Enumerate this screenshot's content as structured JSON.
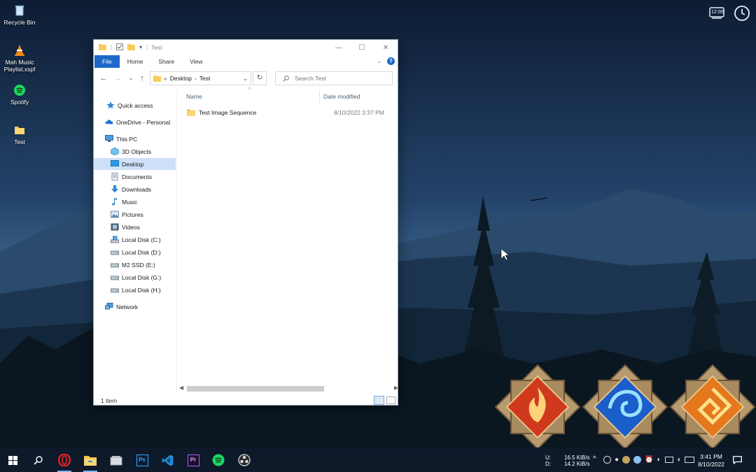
{
  "desktop": {
    "icons": [
      {
        "label": "Recycle Bin",
        "icon": "recycle-bin-icon"
      },
      {
        "label": "Mah Music Playlist.xspf",
        "icon": "vlc-cone-icon"
      },
      {
        "label": "Spotify",
        "icon": "spotify-icon"
      },
      {
        "label": "Test",
        "icon": "folder-icon"
      }
    ],
    "widgets": {
      "clock_badge": "12:00"
    }
  },
  "explorer": {
    "title": "Test",
    "ribbon_tabs": [
      "File",
      "Home",
      "Share",
      "View"
    ],
    "address": {
      "prefix": "«",
      "crumbs": [
        "Desktop",
        "Test"
      ]
    },
    "search_placeholder": "Search Test",
    "nav_items": [
      {
        "label": "Quick access",
        "icon": "star-icon"
      },
      {
        "label": "OneDrive - Personal",
        "icon": "cloud-icon"
      },
      {
        "label": "This PC",
        "icon": "computer-icon"
      },
      {
        "label": "3D Objects",
        "icon": "cube-icon"
      },
      {
        "label": "Desktop",
        "icon": "desktop-icon",
        "selected": true
      },
      {
        "label": "Documents",
        "icon": "document-icon"
      },
      {
        "label": "Downloads",
        "icon": "download-arrow-icon"
      },
      {
        "label": "Music",
        "icon": "music-note-icon"
      },
      {
        "label": "Pictures",
        "icon": "picture-icon"
      },
      {
        "label": "Videos",
        "icon": "film-icon"
      },
      {
        "label": "Local Disk (C:)",
        "icon": "windows-drive-icon"
      },
      {
        "label": "Local Disk (D:)",
        "icon": "drive-icon"
      },
      {
        "label": "M2 SSD (E:)",
        "icon": "drive-icon"
      },
      {
        "label": "Local Disk (G:)",
        "icon": "drive-icon"
      },
      {
        "label": "Local Disk (H:)",
        "icon": "drive-icon"
      },
      {
        "label": "Network",
        "icon": "network-icon"
      }
    ],
    "columns": [
      "Name",
      "Date modified"
    ],
    "files": [
      {
        "name": "Test Image Sequence",
        "date": "8/10/2022 3:37 PM",
        "icon": "folder-icon"
      }
    ],
    "status": "1 item"
  },
  "taskbar": {
    "apps": [
      "start-icon",
      "search-icon",
      "opera-icon",
      "file-explorer-icon",
      "explorer-alt-icon",
      "photoshop-icon",
      "vscode-icon",
      "premiere-icon",
      "spotify-icon",
      "obs-icon"
    ],
    "app_labels": {
      "photoshop": "Ps",
      "premiere": "Pr"
    },
    "net_up_label": "U:",
    "net_down_label": "D:",
    "net_up": "16.5 KiB/s",
    "net_down": "14.2 KiB/s",
    "time": "3:41 PM",
    "date": "8/10/2022"
  },
  "colors": {
    "accent": "#1c69c9",
    "selected": "#cde0f7",
    "taskbar": "#0e1a2a"
  }
}
